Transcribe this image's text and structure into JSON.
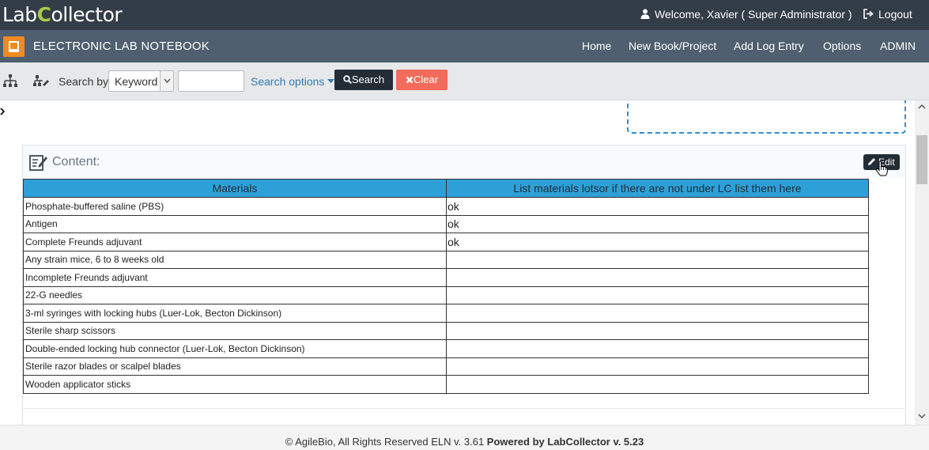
{
  "header": {
    "logo_part1": "Lab",
    "logo_part2": "C",
    "logo_part3": "ollector",
    "welcome": "Welcome, Xavier ( Super Administrator )",
    "logout": "Logout"
  },
  "nav": {
    "app_title": "ELECTRONIC LAB NOTEBOOK",
    "items": [
      "Home",
      "New Book/Project",
      "Add Log Entry",
      "Options",
      "ADMIN"
    ]
  },
  "toolbar": {
    "search_by_label": "Search by",
    "search_by_value": "Keyword",
    "keyword_value": "",
    "search_options": "Search options",
    "search_button": "Search",
    "clear_button": "Clear"
  },
  "panel": {
    "title": "Content:",
    "edit_button": "Edit"
  },
  "table": {
    "headers": [
      "Materials",
      "List materials lotsor if there are not under LC list them here"
    ],
    "rows": [
      [
        "Phosphate-buffered saline (PBS)",
        "ok"
      ],
      [
        "Antigen",
        "ok"
      ],
      [
        "Complete Freunds adjuvant",
        "ok"
      ],
      [
        "Any strain mice, 6 to 8 weeks old",
        ""
      ],
      [
        "Incomplete Freunds adjuvant",
        ""
      ],
      [
        " 22-G needles",
        ""
      ],
      [
        "3-ml syringes with locking hubs (Luer-Lok, Becton Dickinson)",
        ""
      ],
      [
        "Sterile sharp scissors",
        ""
      ],
      [
        "Double-ended locking hub connector (Luer-Lok, Becton Dickinson)",
        ""
      ],
      [
        "Sterile razor blades or scalpel blades",
        ""
      ],
      [
        "Wooden applicator sticks",
        ""
      ]
    ]
  },
  "footer": {
    "text": "© AgileBio, All Rights Reserved ELN v. 3.61 ",
    "powered": "Powered by LabCollector v. 5.23"
  },
  "colors": {
    "topbar": "#333d47",
    "navbar": "#4f5f6f",
    "accent_orange": "#f08a24",
    "table_header": "#2ea0d8",
    "clear_red": "#f26b5b",
    "link_blue": "#337ab7"
  }
}
